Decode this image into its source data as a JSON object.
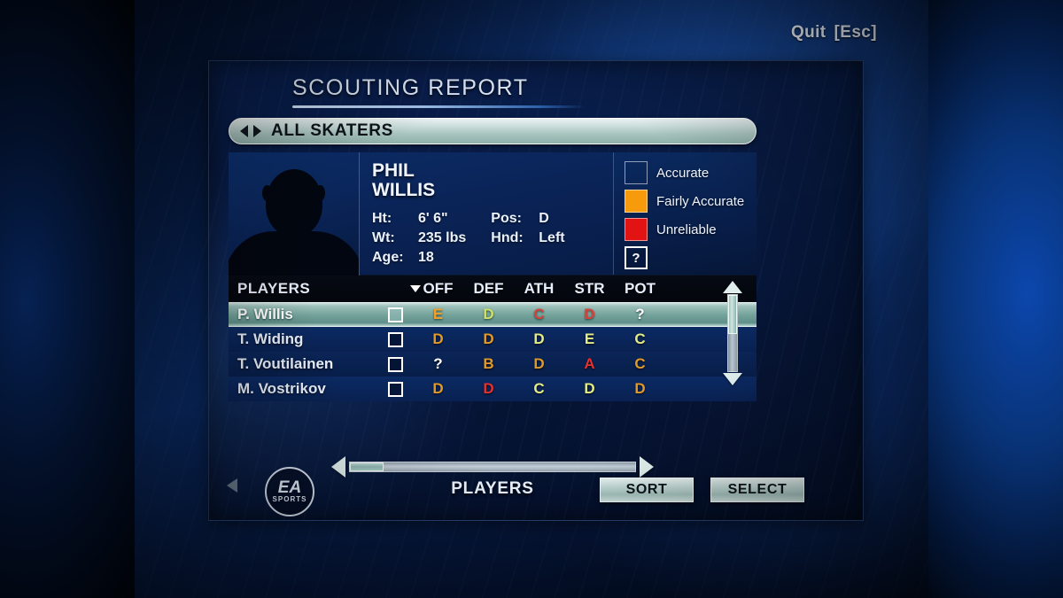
{
  "hud": {
    "quit_label": "Quit",
    "quit_key": "[Esc]"
  },
  "screen": {
    "title": "SCOUTING REPORT"
  },
  "filter": {
    "label": "ALL SKATERS",
    "prev_icon": "triangle-left-icon",
    "next_icon": "triangle-right-icon"
  },
  "player": {
    "first_name": "PHIL",
    "last_name": "WILLIS",
    "ht_label": "Ht:",
    "ht_value": "6' 6\"",
    "wt_label": "Wt:",
    "wt_value": "235 lbs",
    "age_label": "Age:",
    "age_value": "18",
    "pos_label": "Pos:",
    "pos_value": "D",
    "hnd_label": "Hnd:",
    "hnd_value": "Left"
  },
  "legend": {
    "items": [
      {
        "label": "Accurate",
        "color": "#fff濃479"
      },
      {
        "label": "Fairly Accurate",
        "color": "#f79b0c"
      },
      {
        "label": "Unreliable",
        "color": "#e21313"
      }
    ],
    "unknown_symbol": "?"
  },
  "table": {
    "headers": [
      "PLAYERS",
      "OFF",
      "DEF",
      "ATH",
      "STR",
      "POT"
    ],
    "sort_column": "OFF",
    "sort_icon": "sort-descending-caret-icon",
    "rows": [
      {
        "name": "P. Willis",
        "selected": true,
        "checked": false,
        "grades": [
          {
            "v": "E",
            "c": "#f0a02a"
          },
          {
            "v": "D",
            "c": "#cfe06a"
          },
          {
            "v": "C",
            "c": "#d8423a"
          },
          {
            "v": "D",
            "c": "#d8423a"
          },
          {
            "v": "?",
            "c": "#ffffff"
          }
        ]
      },
      {
        "name": "T. Widing",
        "selected": false,
        "checked": false,
        "grades": [
          {
            "v": "D",
            "c": "#e09a2b"
          },
          {
            "v": "D",
            "c": "#e09a2b"
          },
          {
            "v": "D",
            "c": "#e3ec86"
          },
          {
            "v": "E",
            "c": "#e3ec86"
          },
          {
            "v": "C",
            "c": "#e3ec86"
          }
        ]
      },
      {
        "name": "T. Voutilainen",
        "selected": false,
        "checked": false,
        "grades": [
          {
            "v": "?",
            "c": "#ffffff"
          },
          {
            "v": "B",
            "c": "#e09a2b"
          },
          {
            "v": "D",
            "c": "#e09a2b"
          },
          {
            "v": "A",
            "c": "#e53030"
          },
          {
            "v": "C",
            "c": "#e09a2b"
          }
        ]
      },
      {
        "name": "M. Vostrikov",
        "selected": false,
        "checked": false,
        "grades": [
          {
            "v": "D",
            "c": "#e09a2b"
          },
          {
            "v": "D",
            "c": "#e53030"
          },
          {
            "v": "C",
            "c": "#e3ec86"
          },
          {
            "v": "D",
            "c": "#e3ec86"
          },
          {
            "v": "D",
            "c": "#e09a2b"
          }
        ]
      }
    ]
  },
  "scrollbars": {
    "vertical": {
      "up_icon": "arrow-up-icon",
      "down_icon": "arrow-down-icon"
    },
    "horizontal": {
      "left_icon": "arrow-left-icon",
      "right_icon": "arrow-right-icon",
      "label": "PLAYERS"
    }
  },
  "footer": {
    "back_icon": "back-triangle-icon",
    "logo_primary": "EA",
    "logo_secondary": "SPORTS",
    "sort_label": "SORT",
    "select_label": "SELECT"
  }
}
